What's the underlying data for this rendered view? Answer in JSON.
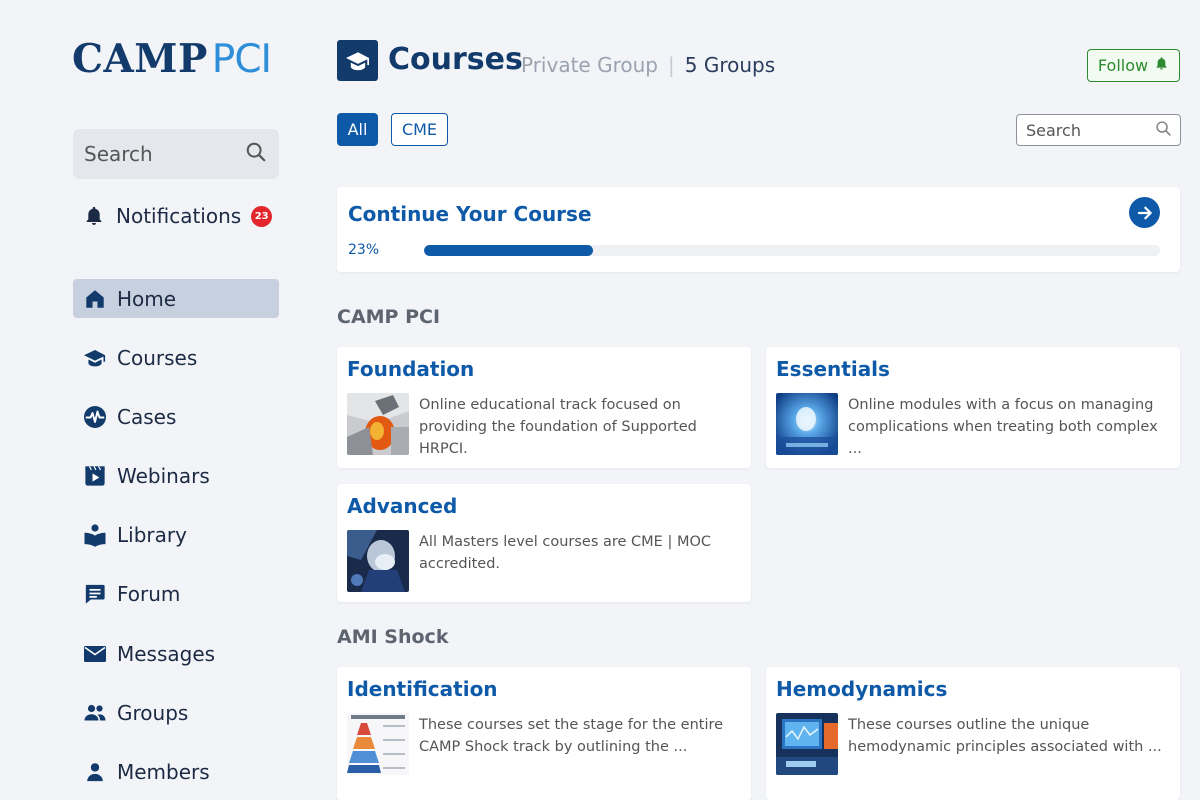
{
  "sidebar": {
    "logo_part1": "CAMP",
    "logo_part2": "PCI",
    "search_placeholder": "Search",
    "notifications": {
      "label": "Notifications",
      "count": "23"
    },
    "items": [
      {
        "label": "Home",
        "icon": "home-icon",
        "active": true
      },
      {
        "label": "Courses",
        "icon": "graduation-cap-icon"
      },
      {
        "label": "Cases",
        "icon": "heartbeat-icon"
      },
      {
        "label": "Webinars",
        "icon": "video-icon"
      },
      {
        "label": "Library",
        "icon": "book-reader-icon"
      },
      {
        "label": "Forum",
        "icon": "forum-icon"
      },
      {
        "label": "Messages",
        "icon": "envelope-icon"
      },
      {
        "label": "Groups",
        "icon": "groups-icon"
      },
      {
        "label": "Members",
        "icon": "person-icon"
      }
    ]
  },
  "header": {
    "title": "Courses",
    "privacy": "Private Group",
    "groups": "5 Groups",
    "follow_label": "Follow"
  },
  "filters": {
    "all": "All",
    "cme": "CME"
  },
  "main_search_placeholder": "Search",
  "continue": {
    "title": "Continue Your Course",
    "percent_label": "23%",
    "progress": 0.23
  },
  "sections": [
    {
      "title": "CAMP PCI",
      "cards": [
        {
          "title": "Foundation",
          "desc": "Online educational track focused on providing the foundation of Supported HRPCI."
        },
        {
          "title": "Essentials",
          "desc": "Online modules with a focus on managing complications when treating both complex ..."
        },
        {
          "title": "Advanced",
          "desc": "All Masters level courses are CME | MOC accredited."
        }
      ]
    },
    {
      "title": "AMI Shock",
      "cards": [
        {
          "title": "Identification",
          "desc": "These courses set the stage for the entire CAMP Shock track by outlining the  ..."
        },
        {
          "title": "Hemodynamics",
          "desc": "These courses outline the unique hemodynamic principles associated with ..."
        }
      ]
    }
  ],
  "colors": {
    "brand_dark": "#123a6b",
    "brand_blue": "#0e5aa8",
    "logo_light": "#2e8fd8",
    "follow_green": "#2e8a2e",
    "badge_red": "#e3262b"
  }
}
